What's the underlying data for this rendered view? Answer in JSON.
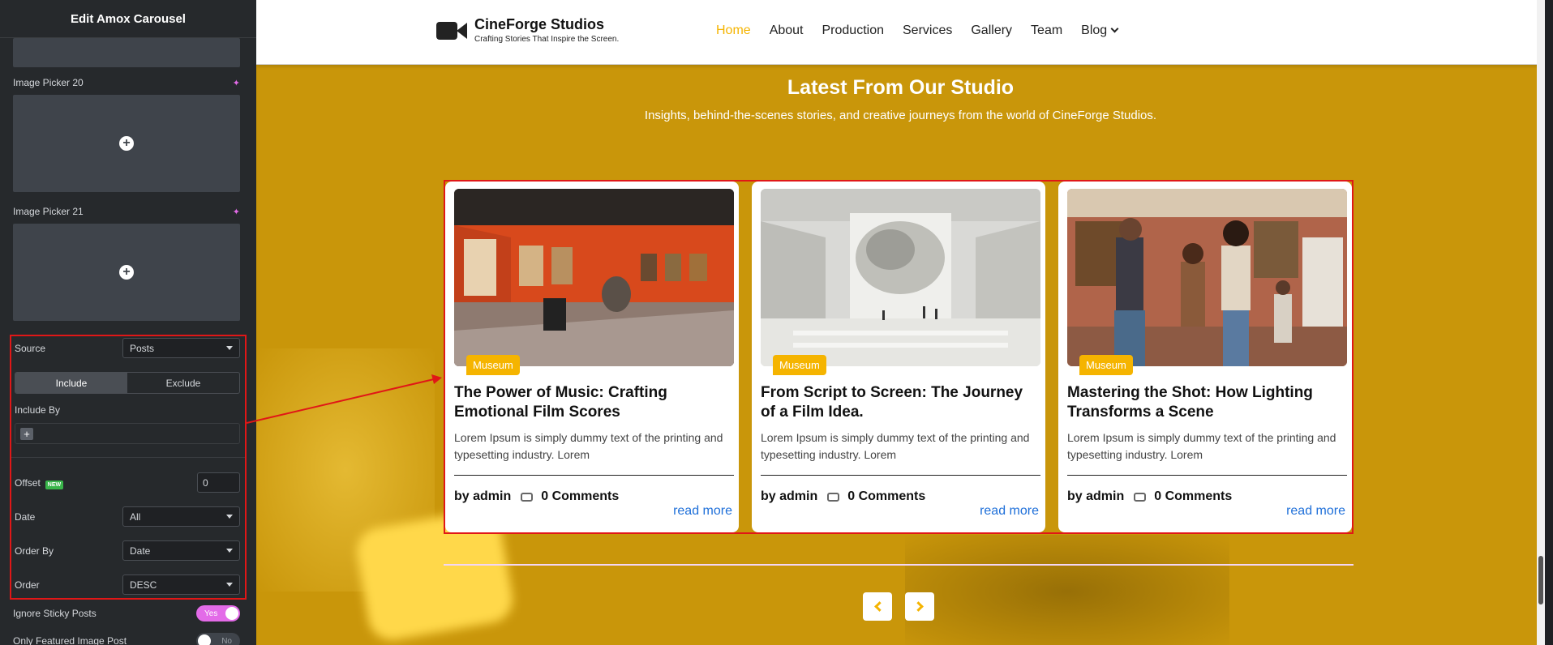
{
  "panel": {
    "title": "Edit Amox Carousel",
    "image_picker_20": "Image Picker 20",
    "image_picker_21": "Image Picker 21",
    "source_label": "Source",
    "source_value": "Posts",
    "tabs": [
      "Include",
      "Exclude"
    ],
    "include_by_label": "Include By",
    "offset_label": "Offset",
    "offset_badge": "NEW",
    "offset_value": "0",
    "date_label": "Date",
    "date_value": "All",
    "order_by_label": "Order By",
    "order_by_value": "Date",
    "order_label": "Order",
    "order_value": "DESC",
    "ignore_sticky_label": "Ignore Sticky Posts",
    "ignore_sticky_value": "Yes",
    "only_featured_label": "Only Featured Image Post",
    "only_featured_value": "No"
  },
  "site": {
    "brand": "CineForge Studios",
    "tagline": "Crafting Stories That Inspire the Screen.",
    "nav": [
      "Home",
      "About",
      "Production",
      "Services",
      "Gallery",
      "Team",
      "Blog"
    ],
    "accent": "#f5b400"
  },
  "section": {
    "title": "Latest From Our Studio",
    "subtitle": "Insights, behind-the-scenes stories, and creative journeys from the world of CineForge Studios."
  },
  "cards": [
    {
      "category": "Museum",
      "title": "The Power of Music: Crafting Emotional Film Scores",
      "excerpt": "Lorem Ipsum is simply dummy text of the printing and typesetting industry. Lorem",
      "author": "by admin",
      "comments": "0 Comments",
      "read_more": "read more"
    },
    {
      "category": "Museum",
      "title": "From Script to Screen: The Journey of a Film Idea.",
      "excerpt": "Lorem Ipsum is simply dummy text of the printing and typesetting industry. Lorem",
      "author": "by admin",
      "comments": "0 Comments",
      "read_more": "read more"
    },
    {
      "category": "Museum",
      "title": "Mastering the Shot: How Lighting Transforms a Scene",
      "excerpt": "Lorem Ipsum is simply dummy text of the printing and typesetting industry. Lorem",
      "author": "by admin",
      "comments": "0 Comments",
      "read_more": "read more"
    }
  ]
}
